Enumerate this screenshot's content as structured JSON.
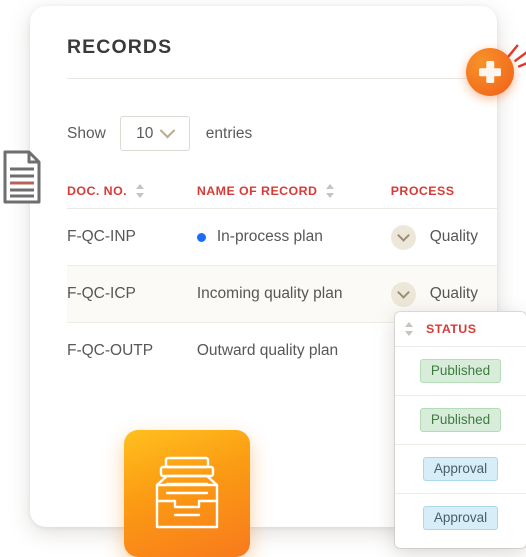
{
  "card": {
    "title": "RECORDS"
  },
  "controls": {
    "show_label": "Show",
    "entries_value": "10",
    "entries_label": "entries",
    "chevron_icon": "chevron-down-icon"
  },
  "table": {
    "columns": [
      {
        "key": "doc_no",
        "label": "DOC. NO."
      },
      {
        "key": "name",
        "label": "NAME OF RECORD"
      },
      {
        "key": "process",
        "label": "PROCESS"
      }
    ],
    "rows": [
      {
        "doc_no": "F-QC-INP",
        "name": "In-process plan",
        "process": "Quality",
        "dot": true,
        "dot_color": "#1b6ef3"
      },
      {
        "doc_no": "F-QC-ICP",
        "name": "Incoming quality plan",
        "process": "Quality",
        "dot": false,
        "dot_color": ""
      },
      {
        "doc_no": "F-QC-OUTP",
        "name": "Outward quality plan",
        "process": "",
        "dot": false,
        "dot_color": ""
      }
    ]
  },
  "status_panel": {
    "header_label": "STATUS",
    "rows": [
      {
        "label": "Published",
        "kind": "published"
      },
      {
        "label": "Published",
        "kind": "published"
      },
      {
        "label": "Approval",
        "kind": "approval"
      },
      {
        "label": "Approval",
        "kind": "approval"
      }
    ]
  },
  "add_button": {
    "icon": "plus-icon",
    "color": "#f4761f",
    "sparkle_color": "#e03a2f"
  },
  "decor": {
    "document_icon": "document-icon",
    "file-tray_icon": "file-tray-icon",
    "tile_color": "#fb9a13"
  },
  "colors": {
    "header_red": "#d93a36",
    "published_bg": "#d8edd9",
    "published_text": "#3f7b43",
    "approval_bg": "#d7edf7",
    "approval_text": "#48606b",
    "row_alt_bg": "#fbfaf6"
  }
}
